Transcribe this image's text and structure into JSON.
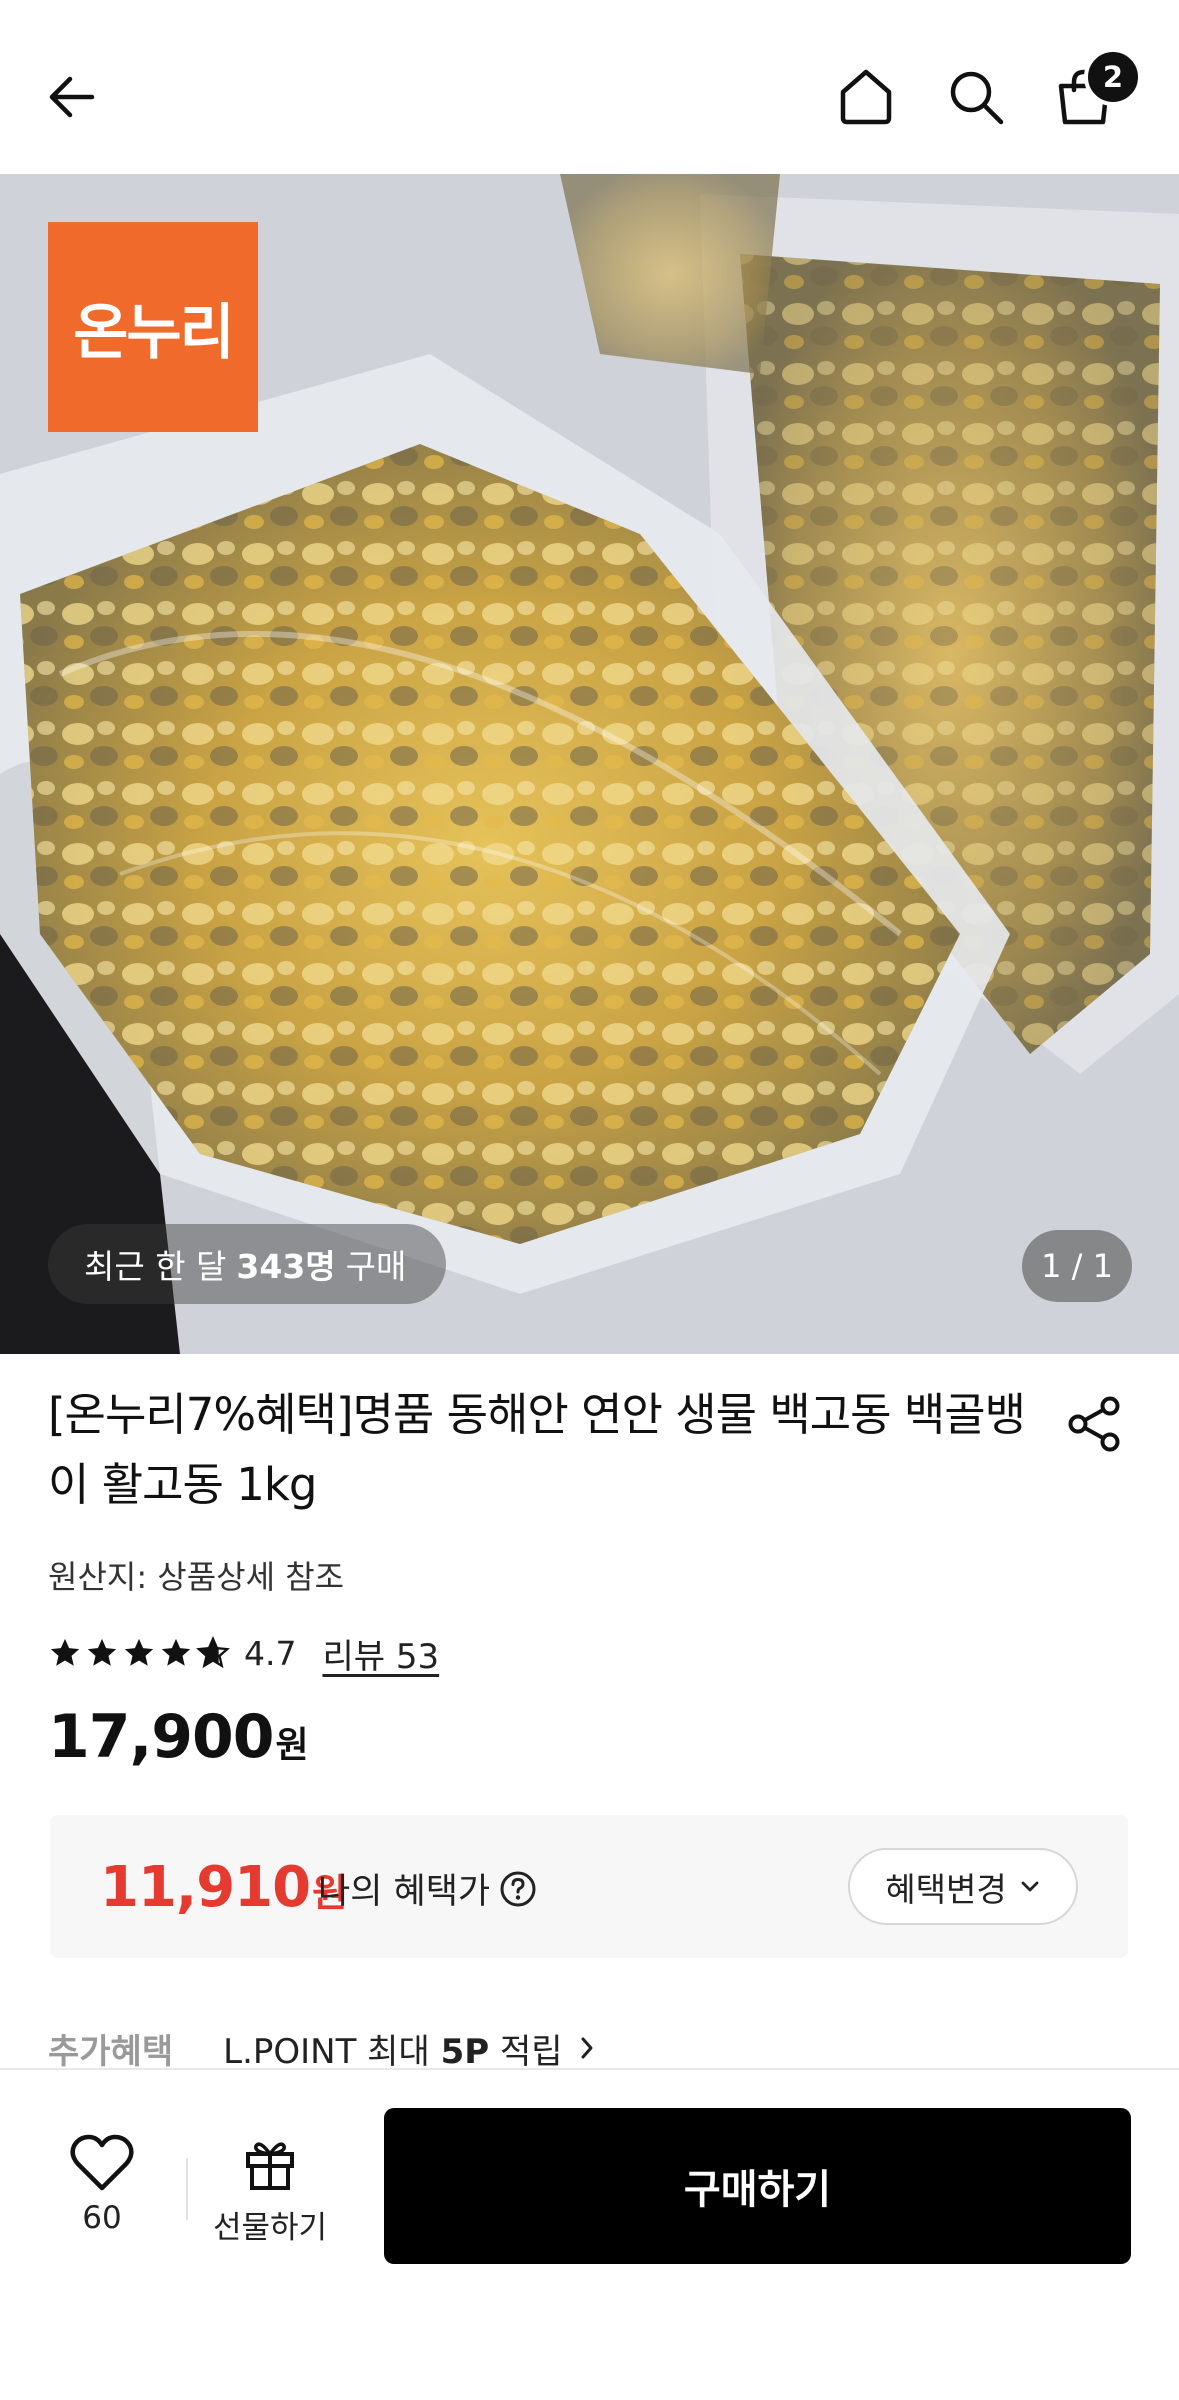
{
  "header": {
    "cart_count": "2"
  },
  "hero": {
    "brand_logo_text": "온누리",
    "purchase_prefix": "최근 한 달",
    "purchase_count": "343명",
    "purchase_suffix": "구매",
    "page_indicator": "1 / 1"
  },
  "product": {
    "title": "[온누리7%혜택]명품 동해안 연안 생물 백고동 백골뱅이 활고동 1kg",
    "origin": "원산지: 상품상세 참조",
    "rating": "4.7",
    "rating_stars": 4.7,
    "review_link": "리뷰 53",
    "price_number": "17,900",
    "price_unit": "원"
  },
  "benefit": {
    "price_number": "11,910",
    "price_unit": "원",
    "label": "나의 혜택가",
    "change_button": "혜택변경",
    "accent_color": "#e53a2f"
  },
  "extra_benefit": {
    "label": "추가혜택",
    "text_prefix": "L.POINT 최대",
    "text_bold": "5P",
    "text_suffix": "적립"
  },
  "bottom_bar": {
    "like_count": "60",
    "gift_label": "선물하기",
    "buy_label": "구매하기"
  },
  "icons": [
    "back-arrow-icon",
    "home-icon",
    "search-icon",
    "shopping-bag-icon",
    "share-icon",
    "star-icon",
    "help-icon",
    "chevron-down-icon",
    "chevron-right-icon",
    "heart-icon",
    "gift-icon"
  ]
}
